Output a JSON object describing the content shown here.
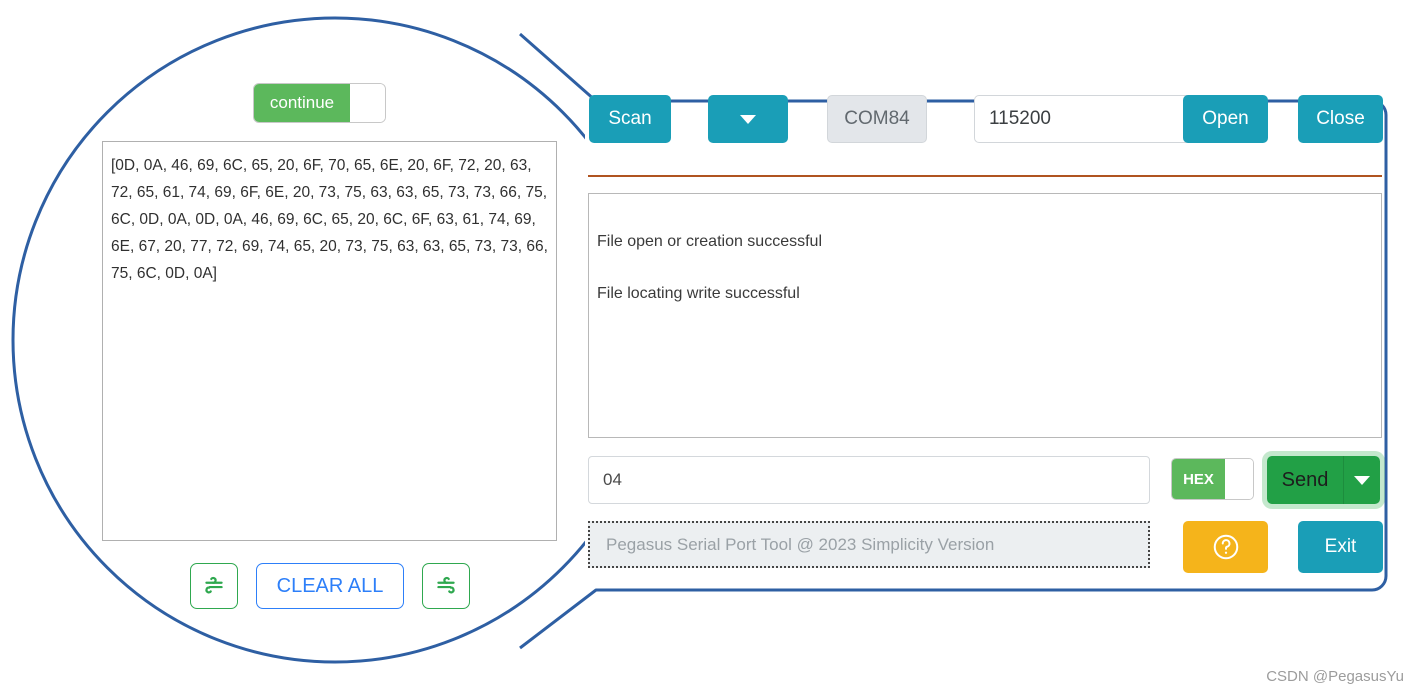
{
  "app": {
    "window_border_color": "#2e5fa3",
    "accent_teal": "#1a9eb7",
    "accent_green": "#22a046",
    "accent_amber": "#f5b41b",
    "accent_blue": "#2d7ff9",
    "divider_color": "#b05420"
  },
  "zoom_region": {
    "continue_toggle": {
      "label": "continue",
      "state": "on",
      "icon": "toggle-switch-icon"
    },
    "hex_dump": {
      "text": "[0D, 0A, 46, 69, 6C, 65, 20, 6F, 70, 65, 6E, 20, 6F, 72, 20, 63, 72, 65, 61, 74, 69, 6F, 6E, 20, 73, 75, 63, 63, 65, 73, 73, 66, 75, 6C, 0D, 0A, 0D, 0A, 46, 69, 6C, 65, 20, 6C, 6F, 63, 61, 74, 69, 6E, 67, 20, 77, 72, 69, 74, 65, 20, 73, 75, 63, 63, 65, 73, 73, 66, 75, 6C, 0D, 0A]"
    },
    "buttons": {
      "wind_left_icon": "wind-left-icon",
      "clear_all_label": "CLEAR ALL",
      "wind_right_icon": "wind-right-icon"
    }
  },
  "toolbar": {
    "scan_label": "Scan",
    "port_dropdown_icon": "chevron-down-icon",
    "port_value": "COM84",
    "baud_value": "115200",
    "baud_dropdown_icon": "chevron-down-icon",
    "open_label": "Open",
    "close_label": "Close"
  },
  "log": {
    "lines": [
      "File open or creation successful",
      "File locating write successful"
    ]
  },
  "send": {
    "input_value": "04",
    "input_placeholder": "",
    "hex_label": "HEX",
    "hex_state": "on",
    "send_label": "Send",
    "send_dropdown_icon": "chevron-down-icon"
  },
  "bottom": {
    "status_text": "Pegasus Serial Port Tool @ 2023 Simplicity Version",
    "help_icon": "question-circle-icon",
    "exit_label": "Exit"
  },
  "watermark": {
    "text": "CSDN @PegasusYu"
  }
}
